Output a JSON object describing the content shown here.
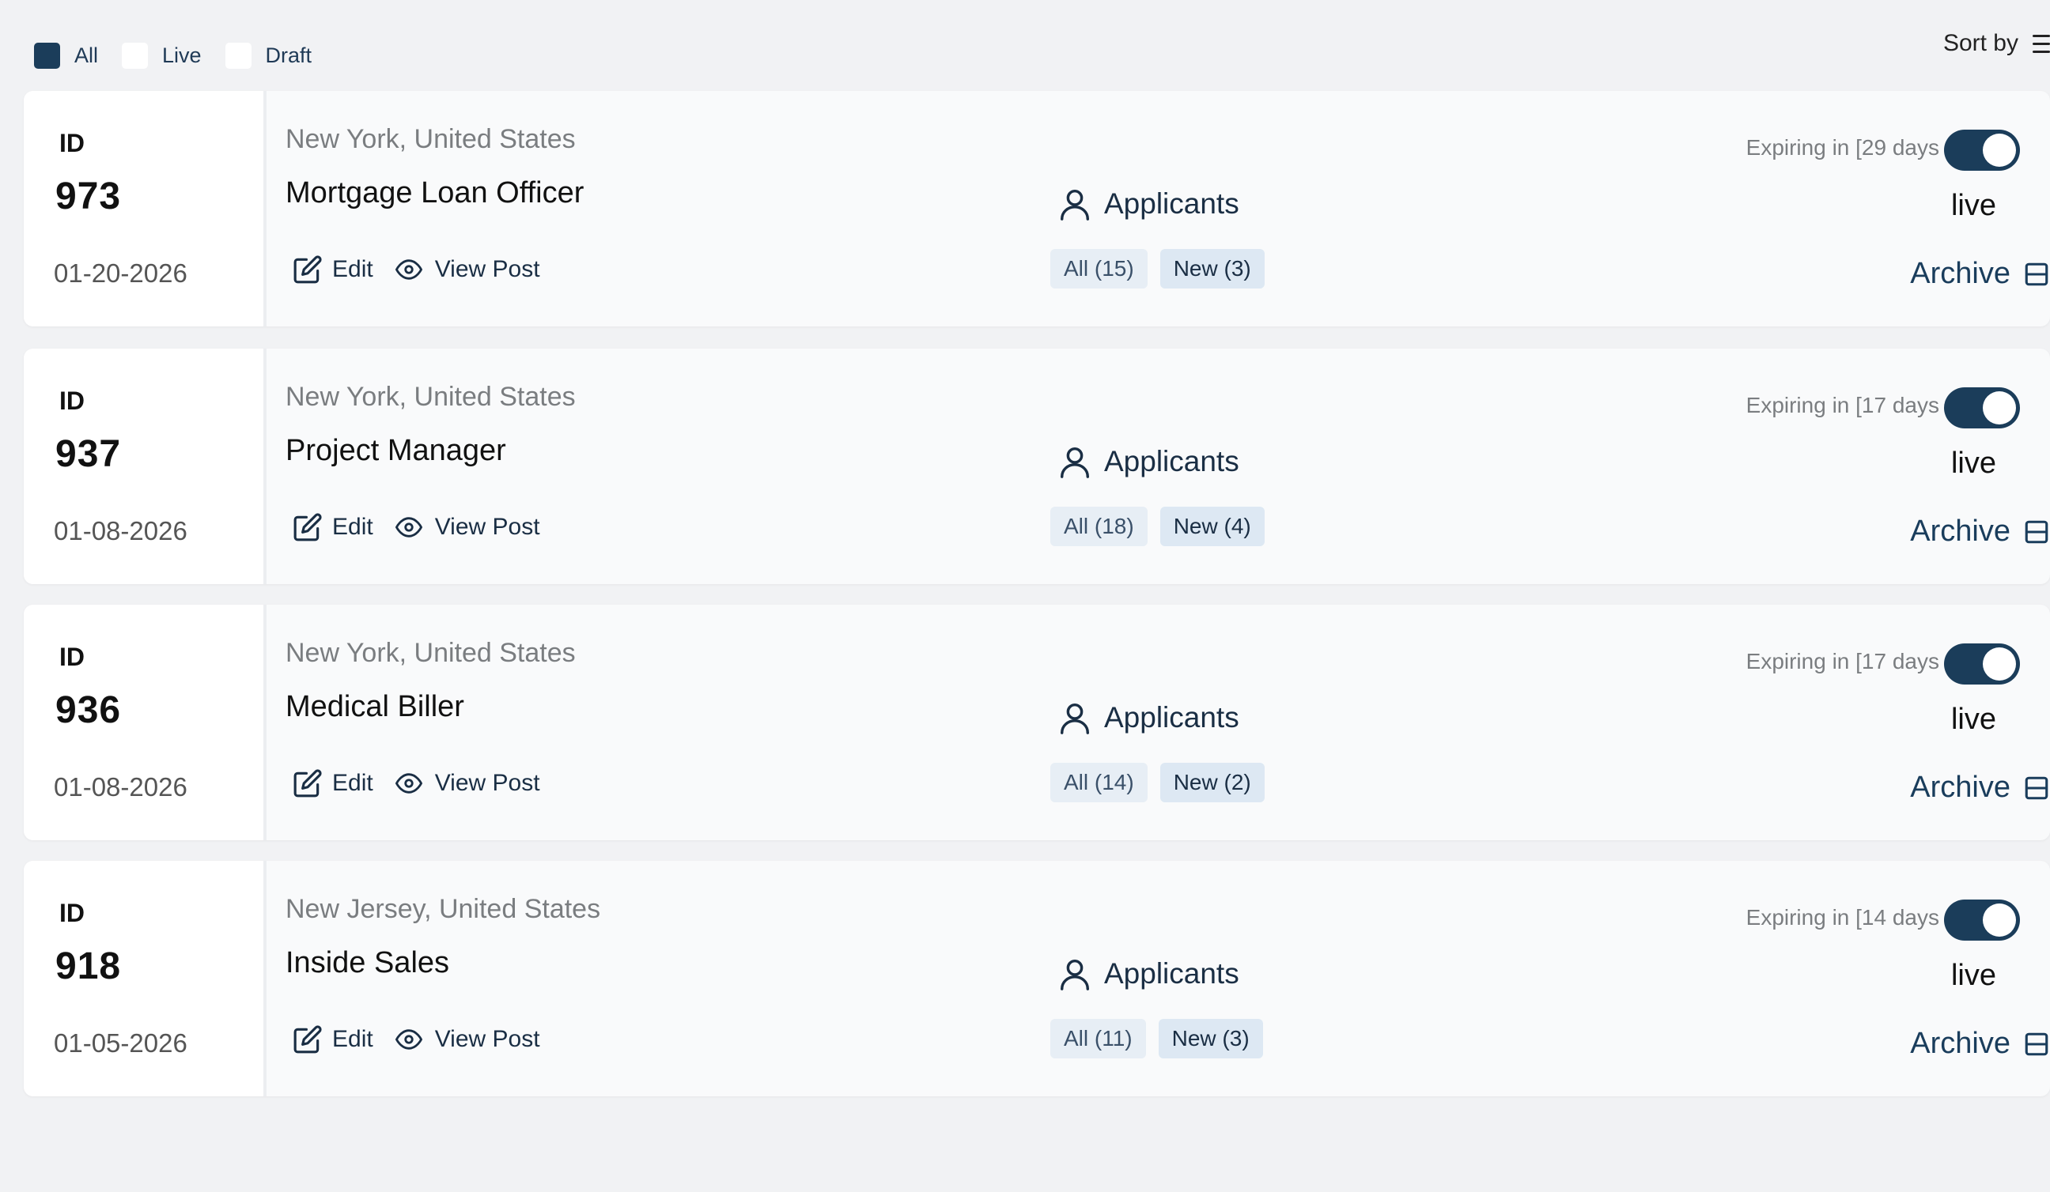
{
  "colors": {
    "accent": "#1b3d5a",
    "background": "#f1f2f4",
    "card": "#f9fafb",
    "pill": "#e7eef5"
  },
  "filters": [
    {
      "label": "All",
      "checked": true
    },
    {
      "label": "Live",
      "checked": false
    },
    {
      "label": "Draft",
      "checked": false
    }
  ],
  "sort": {
    "label": "Sort by",
    "icon": "sort-lines-icon"
  },
  "jobs": [
    {
      "id_label": "ID",
      "id": "973",
      "date": "01-20-2026",
      "location": "New York, United States",
      "title": "Mortgage Loan Officer",
      "edit_label": "Edit",
      "view_label": "View Post",
      "applicants_label": "Applicants",
      "all_count": "All (15)",
      "new_count": "New (3)",
      "expiring": "Expiring in [29 days",
      "live_toggle_on": true,
      "status": "live",
      "archive_label": "Archive"
    },
    {
      "id_label": "ID",
      "id": "937",
      "date": "01-08-2026",
      "location": "New York, United States",
      "title": "Project Manager",
      "edit_label": "Edit",
      "view_label": "View Post",
      "applicants_label": "Applicants",
      "all_count": "All (18)",
      "new_count": "New (4)",
      "expiring": "Expiring in [17 days",
      "live_toggle_on": true,
      "status": "live",
      "archive_label": "Archive"
    },
    {
      "id_label": "ID",
      "id": "936",
      "date": "01-08-2026",
      "location": "New York, United States",
      "title": "Medical Biller",
      "edit_label": "Edit",
      "view_label": "View Post",
      "applicants_label": "Applicants",
      "all_count": "All (14)",
      "new_count": "New (2)",
      "expiring": "Expiring in [17 days",
      "live_toggle_on": true,
      "status": "live",
      "archive_label": "Archive"
    },
    {
      "id_label": "ID",
      "id": "918",
      "date": "01-05-2026",
      "location": "New Jersey, United States",
      "title": "Inside Sales",
      "edit_label": "Edit",
      "view_label": "View Post",
      "applicants_label": "Applicants",
      "all_count": "All (11)",
      "new_count": "New (3)",
      "expiring": "Expiring in [14 days",
      "live_toggle_on": true,
      "status": "live",
      "archive_label": "Archive"
    }
  ]
}
